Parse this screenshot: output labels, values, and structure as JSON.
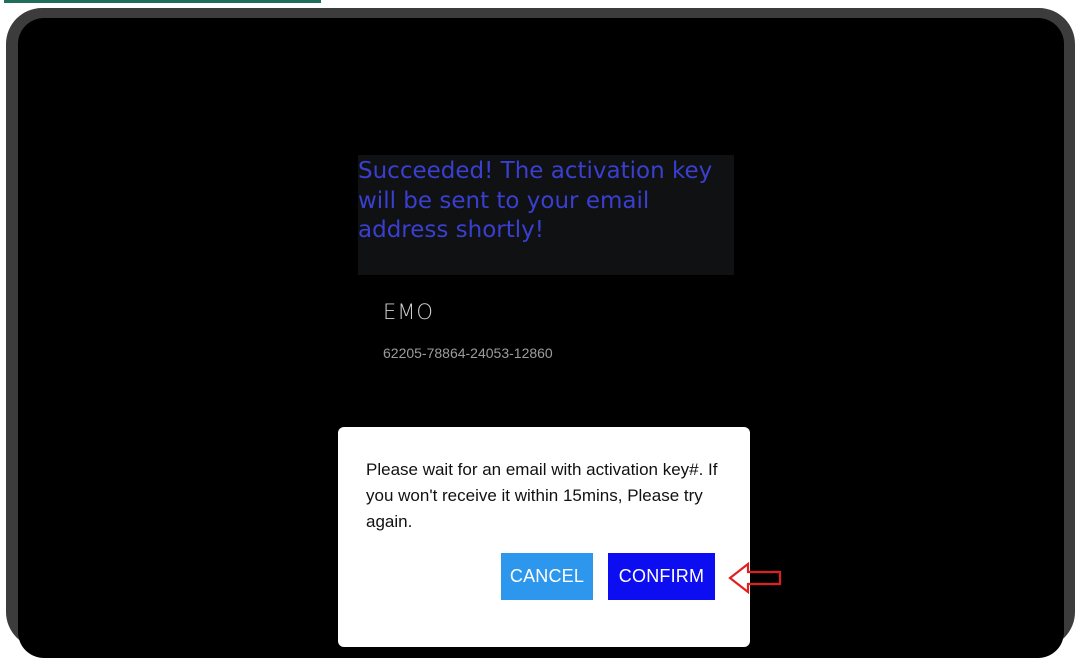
{
  "success_message": "Succeeded! The activation key will be sent to your email address shortly!",
  "app": {
    "name": "EMO",
    "serial": "62205-78864-24053-12860"
  },
  "dialog": {
    "message": "Please wait for an email with activation key#. If you won't receive it within 15mins, Please try again.",
    "cancel_label": "CANCEL",
    "confirm_label": "CONFIRM"
  },
  "annotation": {
    "arrow_icon": "left-arrow-icon",
    "arrow_color": "#e02020"
  },
  "colors": {
    "success_text": "#3a3fd0",
    "cancel_button": "#2d97ee",
    "confirm_button": "#0d0df2",
    "screen_background": "#000000"
  }
}
